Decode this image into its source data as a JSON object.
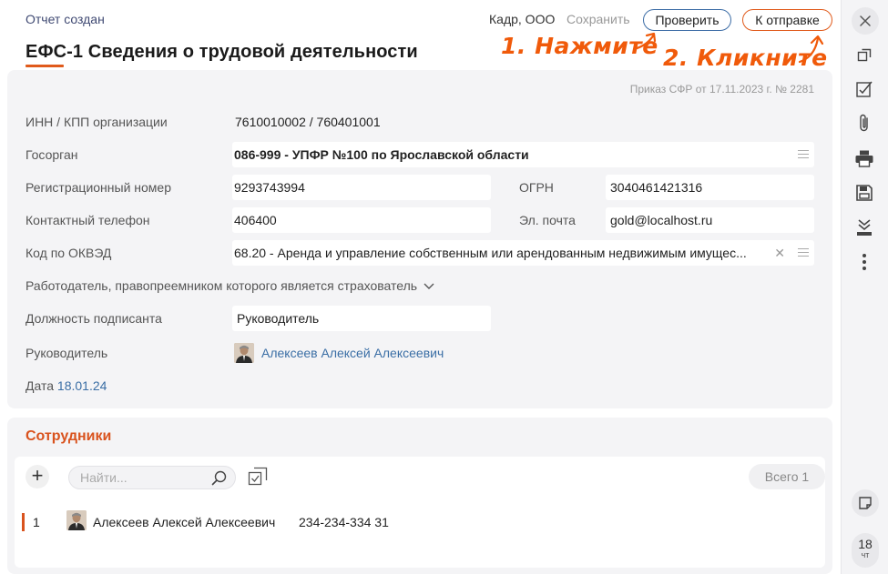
{
  "header": {
    "status": "Отчет создан",
    "title": "ЕФС-1 Сведения о трудовой деятельности",
    "org_name": "Кадр, ООО",
    "save_label": "Сохранить",
    "check_label": "Проверить",
    "send_label": "К отправке"
  },
  "hints": {
    "step1": "1. Нажмите",
    "step2": "2. Кликните"
  },
  "form": {
    "order_note": "Приказ СФР от 17.11.2023 г. № 2281",
    "inn_kpp_label": "ИНН / КПП организации",
    "inn_kpp_value": "7610010002 / 760401001",
    "gov_label": "Госорган",
    "gov_value": "086-999 - УПФР №100 по Ярославской области",
    "reg_label": "Регистрационный номер",
    "reg_value": "9293743994",
    "ogrn_label": "ОГРН",
    "ogrn_value": "3040461421316",
    "phone_label": "Контактный телефон",
    "phone_value": "406400",
    "email_label": "Эл. почта",
    "email_value": "gold@localhost.ru",
    "okved_label": "Код по ОКВЭД",
    "okved_value": "68.20 - Аренда и управление собственным или арендованным недвижимым имущес...",
    "successor_label": "Работодатель, правопреемником которого является страхователь",
    "signer_position_label": "Должность подписанта",
    "signer_position_value": "Руководитель",
    "head_label": "Руководитель",
    "head_name": "Алексеев Алексей Алексеевич",
    "date_label": "Дата",
    "date_value": "18.01.24"
  },
  "employees": {
    "title": "Сотрудники",
    "search_placeholder": "Найти...",
    "total": "Всего 1",
    "rows": [
      {
        "num": "1",
        "name": "Алексеев Алексей Алексеевич",
        "snils": "234-234-334 31"
      }
    ]
  },
  "sidebar": {
    "icons": [
      "close-icon",
      "copy-icon",
      "check-report-icon",
      "paperclip-icon",
      "printer-icon",
      "save-icon",
      "upload-icon",
      "more-icon",
      "note-icon"
    ],
    "calendar_day": "18",
    "calendar_weekday": "чт"
  },
  "colors": {
    "accent": "#e05a1b",
    "link": "#3a6ea5",
    "hint": "#f05a0a",
    "panel": "#f4f4f6"
  }
}
